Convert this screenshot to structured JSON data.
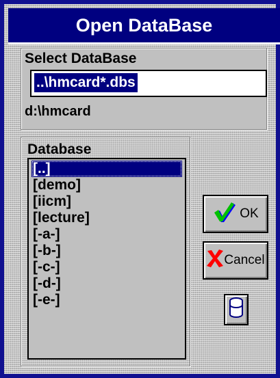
{
  "dialog": {
    "title": "Open DataBase"
  },
  "select_group": {
    "label": "Select DataBase",
    "input_value": "..\\hmcard*.dbs",
    "current_dir": "d:\\hmcard"
  },
  "database_group": {
    "label": "Database",
    "items": [
      "[..]",
      "[demo]",
      "[iicm]",
      "[lecture]",
      "[-a-]",
      "[-b-]",
      "[-c-]",
      "[-d-]",
      "[-e-]"
    ],
    "selected_index": 0
  },
  "buttons": {
    "ok_label": "OK",
    "cancel_label": "Cancel",
    "ok_icon": "checkmark-icon",
    "cancel_icon": "x-icon",
    "database_icon": "database-cylinder-icon"
  },
  "colors": {
    "title_bg": "#000080",
    "selection_bg": "#000080",
    "check_green": "#00c000",
    "check_blue": "#0000ff",
    "x_red": "#ff0000"
  }
}
